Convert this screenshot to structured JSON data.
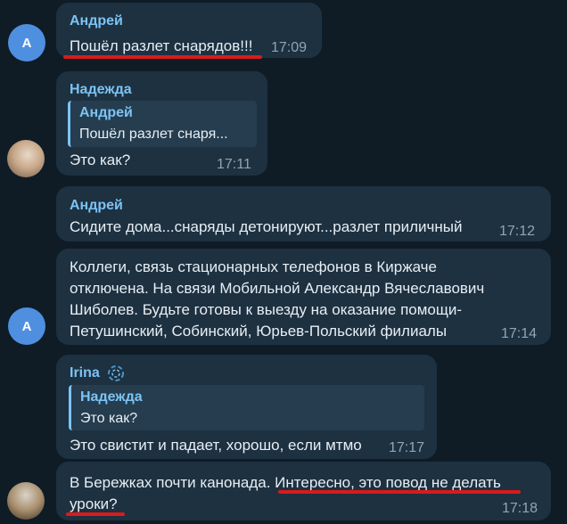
{
  "messages": [
    {
      "author": "Андрей",
      "text": "Пошёл разлет снарядов!!!",
      "time": "17:09"
    },
    {
      "author": "Надежда",
      "quote_author": "Андрей",
      "quote_text": "Пошёл разлет снаря...",
      "text": "Это как?",
      "time": "17:11"
    },
    {
      "author": "Андрей",
      "text": "Сидите дома...снаряды детонируют...разлет приличный",
      "time": "17:12"
    },
    {
      "lines": [
        "Коллеги, связь стационарных телефонов в Киржаче",
        "отключена. На связи  Мобильной Александр Вячеславович",
        "Шиболев. Будьте готовы к выезду на оказание помощи-",
        "Петушинский, Собинский, Юрьев-Польский филиалы"
      ],
      "time": "17:14"
    },
    {
      "author": "Irina",
      "quote_author": "Надежда",
      "quote_text": "Это как?",
      "text": "Это свистит и падает, хорошо, если мтмо",
      "time": "17:17"
    },
    {
      "lines": [
        "В Бережках почти канонада. Интересно, это повод не делать",
        "уроки?"
      ],
      "time": "17:18"
    }
  ],
  "avatars": {
    "andrey_initial": "А"
  },
  "colors": {
    "accent": "#7cc3f4",
    "bubble": "#1d3141",
    "underline": "#d91b1b"
  }
}
